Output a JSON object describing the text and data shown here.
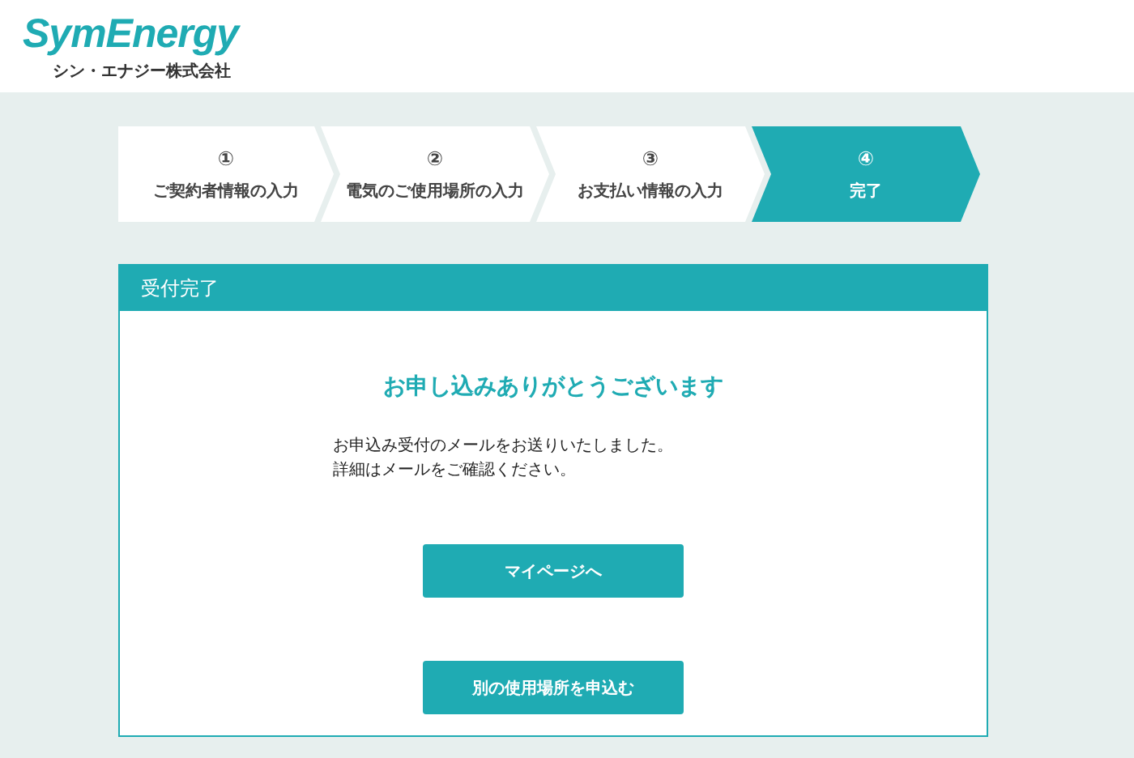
{
  "header": {
    "logo": "SymEnergy",
    "company": "シン・エナジー株式会社"
  },
  "steps": [
    {
      "number": "①",
      "label": "ご契約者情報の入力",
      "selected": false
    },
    {
      "number": "②",
      "label": "電気のご使用場所の入力",
      "selected": false
    },
    {
      "number": "③",
      "label": "お支払い情報の入力",
      "selected": false
    },
    {
      "number": "④",
      "label": "完了",
      "selected": true
    }
  ],
  "card": {
    "title": "受付完了",
    "heading": "お申し込みありがとうございます",
    "message": [
      "お申込み受付のメールをお送りいたしました。",
      "詳細はメールをご確認ください。"
    ],
    "buttons": [
      "マイページへ",
      "別の使用場所を申込む"
    ]
  }
}
